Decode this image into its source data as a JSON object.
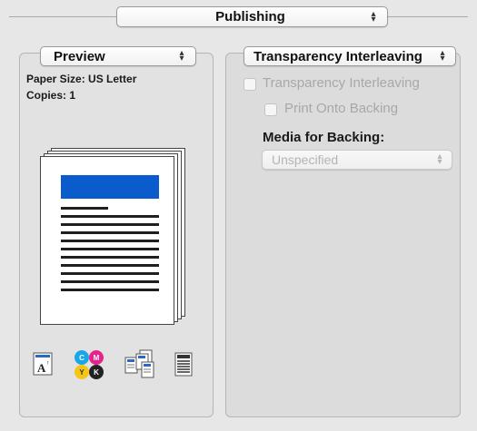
{
  "header": {
    "section_popup": "Publishing"
  },
  "preview": {
    "popup_label": "Preview",
    "paper_size": "Paper Size: US Letter",
    "copies": "Copies: 1",
    "header_color": "#0a5ccc",
    "icons": [
      "text-orientation-icon",
      "cmyk-color-icon",
      "page-layout-icon",
      "document-lines-icon"
    ],
    "cmyk": {
      "c": "C",
      "m": "M",
      "y": "Y",
      "k": "K"
    },
    "text_icon_letter": "A"
  },
  "transparency": {
    "popup_label": "Transparency Interleaving",
    "interleaving_checkbox_label": "Transparency Interleaving",
    "backing_checkbox_label": "Print Onto Backing",
    "media_label": "Media for Backing:",
    "media_select_value": "Unspecified"
  }
}
